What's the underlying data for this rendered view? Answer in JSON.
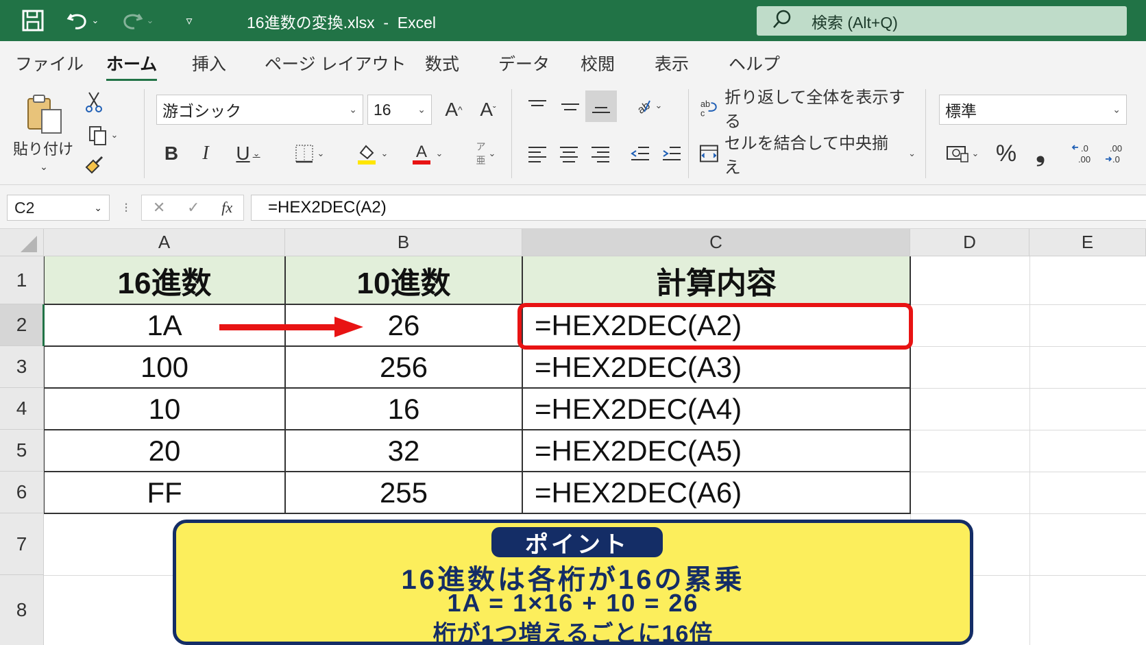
{
  "titlebar": {
    "doc_title": "16進数の変換.xlsx  -  Excel",
    "search_label": "検索 (Alt+Q)"
  },
  "menu": {
    "tabs": [
      "ファイル",
      "ホーム",
      "挿入",
      "ページ レイアウト",
      "数式",
      "データ",
      "校閲",
      "表示",
      "ヘルプ"
    ],
    "active": "ホーム"
  },
  "ribbon": {
    "paste_label": "貼り付け",
    "font_name": "游ゴシック",
    "font_size": "16",
    "wrap_text_label": "折り返して全体を表示する",
    "merge_center_label": "セルを結合して中央揃え",
    "number_format": "標準",
    "bold": "B",
    "italic": "I",
    "underline": "U",
    "percent": "%",
    "comma": "❟",
    "font_color": "#e81313",
    "fill_color": "#ffe600"
  },
  "formula_bar": {
    "name_box": "C2",
    "fx": "fx",
    "formula": "=HEX2DEC(A2)"
  },
  "columns": [
    "A",
    "B",
    "C",
    "D",
    "E"
  ],
  "rows": [
    "1",
    "2",
    "3",
    "4",
    "5",
    "6",
    "7",
    "8"
  ],
  "table": {
    "headers": [
      "16進数",
      "10進数",
      "計算内容"
    ],
    "data": [
      [
        "1A",
        "26",
        "=HEX2DEC(A2)"
      ],
      [
        "100",
        "256",
        "=HEX2DEC(A3)"
      ],
      [
        "10",
        "16",
        "=HEX2DEC(A4)"
      ],
      [
        "20",
        "32",
        "=HEX2DEC(A5)"
      ],
      [
        "FF",
        "255",
        "=HEX2DEC(A6)"
      ]
    ]
  },
  "point": {
    "badge": "ポイント",
    "line1": "16進数は各桁が16の累乗",
    "line2": "1A = 1×16 + 10 = 26",
    "line3": "桁が1つ増えるごとに16倍"
  },
  "colors": {
    "excel_green": "#217346",
    "header_fill": "#e2efda",
    "highlight": "#e81313",
    "callout_fill": "#fcee5c",
    "callout_navy": "#142d66"
  }
}
